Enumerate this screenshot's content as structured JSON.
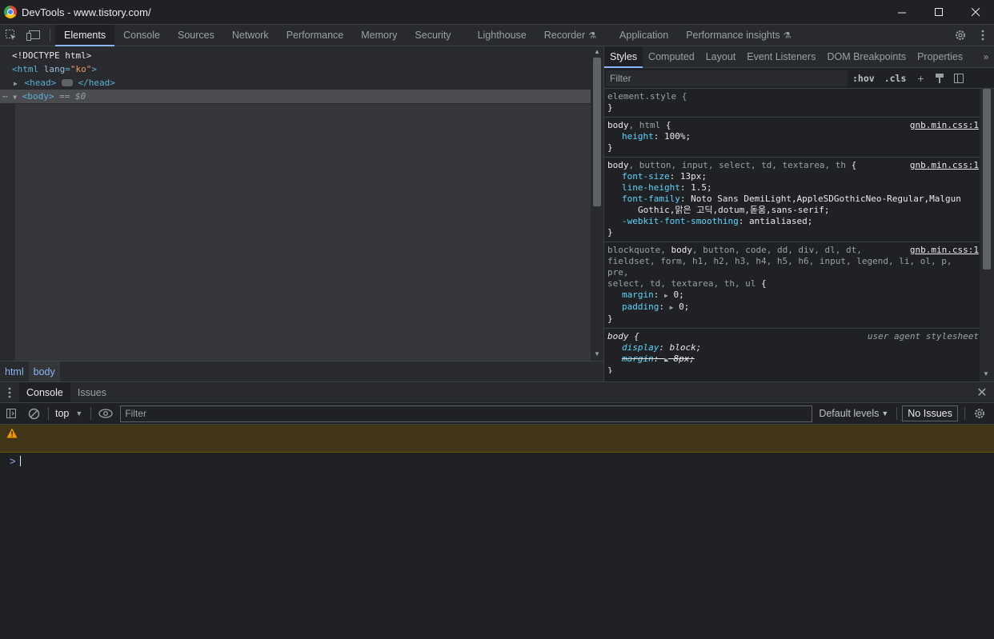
{
  "window": {
    "title": "DevTools - www.tistory.com/"
  },
  "main_tabs": [
    {
      "label": "Elements"
    },
    {
      "label": "Console"
    },
    {
      "label": "Sources"
    },
    {
      "label": "Network"
    },
    {
      "label": "Performance"
    },
    {
      "label": "Memory"
    },
    {
      "label": "Security"
    },
    {
      "label": "Lighthouse"
    },
    {
      "label": "Recorder"
    },
    {
      "label": "Application"
    },
    {
      "label": "Performance insights"
    }
  ],
  "dom": {
    "doctype": "<!DOCTYPE html>",
    "html_open": "<html",
    "html_attr": "lang",
    "html_attr_value": "\"ko\"",
    "head_open": "<head>",
    "head_close": "</head>",
    "body_open": "<body>",
    "selected_marker": "== $0"
  },
  "breadcrumbs": [
    "html",
    "body"
  ],
  "styles_tabs": [
    {
      "label": "Styles"
    },
    {
      "label": "Computed"
    },
    {
      "label": "Layout"
    },
    {
      "label": "Event Listeners"
    },
    {
      "label": "DOM Breakpoints"
    },
    {
      "label": "Properties"
    }
  ],
  "styles_toolbar": {
    "filter_placeholder": "Filter",
    "hov": ":hov",
    "cls": ".cls"
  },
  "rules": {
    "r0": {
      "selector": "element.style {",
      "close": "}"
    },
    "r1": {
      "sel_match": "body",
      "sel_rest": ", html",
      "brace": " {",
      "source": "gnb.min.css:1",
      "p1_name": "height",
      "p1_val": "100%;",
      "close": "}"
    },
    "r2": {
      "sel_match": "body",
      "sel_rest": ", button, input, select, td, textarea, th",
      "brace": " {",
      "source": "gnb.min.css:1",
      "p1_name": "font-size",
      "p1_val": "13px;",
      "p2_name": "line-height",
      "p2_val": "1.5;",
      "p3_name": "font-family",
      "p3_val": "Noto Sans DemiLight,AppleSDGothicNeo-Regular,Malgun",
      "p3_wrap": "Gothic,맑은 고딕,dotum,돋움,sans-serif;",
      "p4_name": "-webkit-font-smoothing",
      "p4_val": "antialiased;",
      "close": "}"
    },
    "r3": {
      "sel_a": "blockquote, ",
      "sel_match": "body",
      "sel_b": ", button, code, dd, div, dl, dt,",
      "sel_c": "fieldset, form, h1, h2, h3, h4, h5, h6, input, legend, li, ol, p, pre,",
      "sel_d": "select, td, textarea, th, ul",
      "brace": " {",
      "source": "gnb.min.css:1",
      "p1_name": "margin",
      "p1_val": "0;",
      "p2_name": "padding",
      "p2_val": "0;",
      "close": "}"
    },
    "r4": {
      "sel_match": "body",
      "brace": " {",
      "source": "user agent stylesheet",
      "p1_name": "display",
      "p1_val": "block;",
      "p2_name": "margin",
      "p2_val": "8px;",
      "close": "}"
    }
  },
  "drawer": {
    "tabs": [
      {
        "label": "Console"
      },
      {
        "label": "Issues"
      }
    ],
    "context": "top",
    "filter_placeholder": "Filter",
    "levels": "Default levels",
    "issues_button": "No Issues",
    "prompt": ">"
  },
  "colors": {
    "accent": "#8ab4f8",
    "warning_bg": "#413618",
    "warning_icon": "#f29900"
  }
}
